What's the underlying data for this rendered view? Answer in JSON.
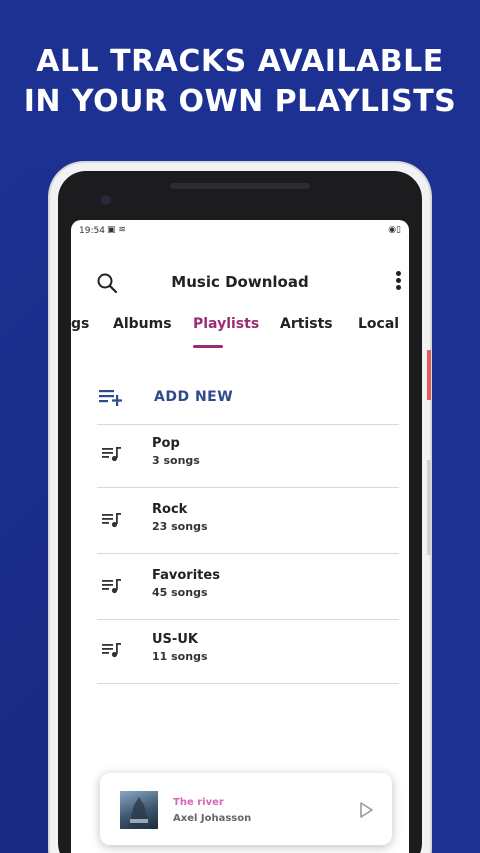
{
  "headline": {
    "line1": "ALL TRACKS AVAILABLE",
    "line2": "IN YOUR OWN PLAYLISTS"
  },
  "statusbar": {
    "time": "19:54"
  },
  "appbar": {
    "title": "Music Download"
  },
  "tabs": [
    {
      "label": "gs"
    },
    {
      "label": "Albums"
    },
    {
      "label": "Playlists",
      "active": true
    },
    {
      "label": "Artists"
    },
    {
      "label": "Local"
    }
  ],
  "add_new": {
    "label": "ADD NEW"
  },
  "playlists": [
    {
      "name": "Pop",
      "count": "3 songs"
    },
    {
      "name": "Rock",
      "count": "23 songs"
    },
    {
      "name": "Favorites",
      "count": "45 songs"
    },
    {
      "name": "US-UK",
      "count": "11 songs"
    }
  ],
  "player": {
    "title": "The river",
    "artist": "Axel Johasson"
  },
  "colors": {
    "background": "#1d3192",
    "accent": "#9c2c72",
    "add_new": "#2d4a8a",
    "track_title": "#d667b8"
  },
  "icons": {
    "search": "search-icon",
    "menu": "more-vert-icon",
    "add_playlist": "playlist-add-icon",
    "playlist": "queue-music-icon",
    "play": "play-icon"
  }
}
